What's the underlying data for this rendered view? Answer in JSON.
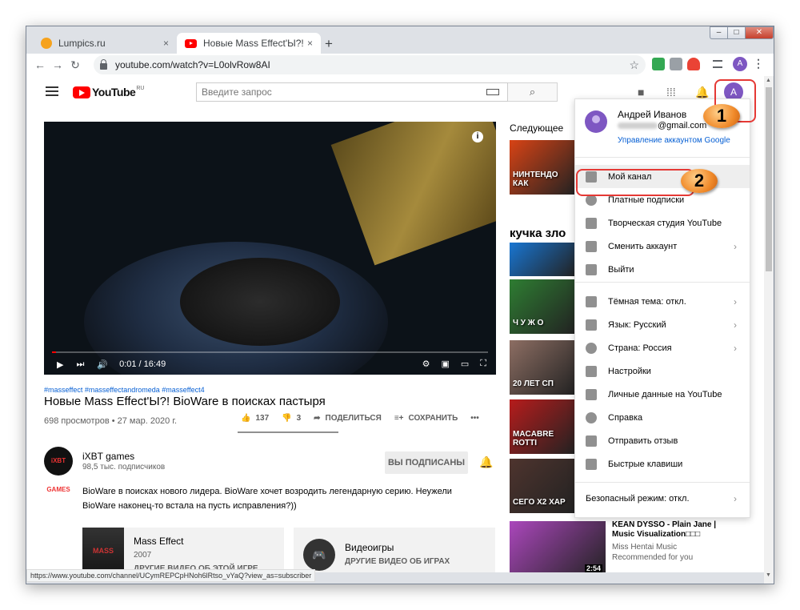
{
  "browser": {
    "tabs": [
      {
        "title": "Lumpics.ru",
        "close": "×"
      },
      {
        "title": "Новые Mass Effect'Ы?! BioWare в",
        "close": "×"
      }
    ],
    "new_tab": "+",
    "window_controls": {
      "minimize": "–",
      "maximize": "□",
      "close": "✕"
    },
    "url": "youtube.com/watch?v=L0olvRow8AI",
    "profile_letter": "A",
    "status_url": "https://www.youtube.com/channel/UCymREPCpHNoh6lRtso_vYaQ?view_as=subscriber"
  },
  "youtube": {
    "logo_text": "YouTube",
    "logo_region": "RU",
    "search_placeholder": "Введите запрос",
    "avatar_letter": "A"
  },
  "video": {
    "time": "0:01 / 16:49",
    "progress_fraction": 0.01,
    "tags": "#masseffect #masseffectandromeda #masseffect4",
    "title": "Новые Mass Effect'Ы?! BioWare в поисках пастыря",
    "meta": "698 просмотров • 27 мар. 2020 г.",
    "likes": "137",
    "dislikes": "3",
    "share": "ПОДЕЛИТЬСЯ",
    "save": "СОХРАНИТЬ",
    "more": "•••"
  },
  "channel": {
    "logo_text": "iXBT GAMES",
    "name": "iXBT games",
    "subscribers": "98,5 тыс. подписчиков",
    "subscribe_label": "ВЫ ПОДПИСАНЫ",
    "description": "BioWare в поисках нового лидера. BioWare хочет возродить легендарную серию. Неужели BioWare наконец-то встала на пусть исправления?))"
  },
  "cards": {
    "game": {
      "cover": "MASS",
      "title": "Mass Effect",
      "year": "2007",
      "link": "ДРУГИЕ ВИДЕО ОБ ЭТОЙ ИГРЕ"
    },
    "category": {
      "title": "Видеоигры",
      "link": "ДРУГИЕ ВИДЕО ОБ ИГРАХ"
    }
  },
  "sidebar": {
    "next_label": "Следующее",
    "thumbs": [
      {
        "text": "НИНТЕНДО КАК",
        "color": "#d84315"
      },
      {
        "text": "кучка зло",
        "color": "#1976d2"
      },
      {
        "text": "Ч У Ж О",
        "color": "#2e7d32"
      },
      {
        "text": "20 ЛЕТ СП",
        "color": "#8d6e63"
      },
      {
        "text": "MACABRE ROTTI",
        "color": "#b71c1c"
      },
      {
        "text": "CEГO X2 ХАР",
        "color": "#4e342e"
      },
      {
        "text": "",
        "color": "#ab47bc",
        "duration": "2:54"
      }
    ],
    "recommended": {
      "title": "KEAN DYSSO - Plain Jane | Music Visualization□□□",
      "channel": "Miss Hentai Music",
      "note": "Recommended for you"
    }
  },
  "account_menu": {
    "name": "Андрей Иванов",
    "email_suffix": "@gmail.com",
    "manage": "Управление аккаунтом Google",
    "items_group1": [
      {
        "label": "Мой канал",
        "icon": "person-icon"
      },
      {
        "label": "Платные подписки",
        "icon": "dollar-icon"
      },
      {
        "label": "Творческая студия YouTube",
        "icon": "gear-icon"
      },
      {
        "label": "Сменить аккаунт",
        "icon": "switch-account-icon",
        "chevron": true
      },
      {
        "label": "Выйти",
        "icon": "logout-icon"
      }
    ],
    "items_group2": [
      {
        "label": "Тёмная тема: откл.",
        "icon": "dark-theme-icon",
        "chevron": true
      },
      {
        "label": "Язык: Русский",
        "icon": "translate-icon",
        "chevron": true
      },
      {
        "label": "Страна: Россия",
        "icon": "globe-icon",
        "chevron": true
      },
      {
        "label": "Настройки",
        "icon": "settings-icon"
      },
      {
        "label": "Личные данные на YouTube",
        "icon": "shield-icon"
      },
      {
        "label": "Справка",
        "icon": "help-icon"
      },
      {
        "label": "Отправить отзыв",
        "icon": "feedback-icon"
      },
      {
        "label": "Быстрые клавиши",
        "icon": "keyboard-icon"
      }
    ],
    "safe_mode": "Безопасный режим: откл."
  },
  "annotations": {
    "step1": "1",
    "step2": "2"
  },
  "colors": {
    "accent": "#ff0000",
    "link": "#065fd4",
    "avatar": "#7e57c2",
    "badge": "#f08a2a"
  }
}
